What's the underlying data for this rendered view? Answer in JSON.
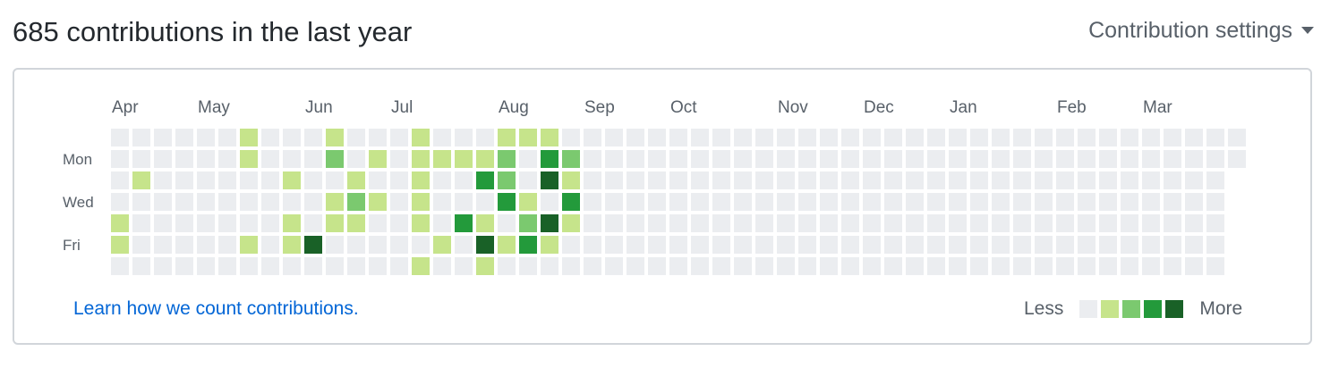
{
  "header": {
    "title": "685 contributions in the last year",
    "settings_label": "Contribution settings",
    "settings_icon": "caret-down-icon"
  },
  "calendar": {
    "months": [
      {
        "label": "Apr",
        "week": 0
      },
      {
        "label": "May",
        "week": 4
      },
      {
        "label": "Jun",
        "week": 9
      },
      {
        "label": "Jul",
        "week": 13
      },
      {
        "label": "Aug",
        "week": 18
      },
      {
        "label": "Sep",
        "week": 22
      },
      {
        "label": "Oct",
        "week": 26
      },
      {
        "label": "Nov",
        "week": 31
      },
      {
        "label": "Dec",
        "week": 35
      },
      {
        "label": "Jan",
        "week": 39
      },
      {
        "label": "Feb",
        "week": 44
      },
      {
        "label": "Mar",
        "week": 48
      }
    ],
    "day_labels": [
      {
        "label": "Mon",
        "row": 1
      },
      {
        "label": "Wed",
        "row": 3
      },
      {
        "label": "Fri",
        "row": 5
      }
    ],
    "week_count": 53,
    "last_week_days": 2,
    "levels": [
      [
        0,
        0,
        0,
        0,
        0,
        0,
        1,
        0,
        0,
        0,
        1,
        0,
        0,
        0,
        1,
        0,
        0,
        0,
        1,
        1,
        1,
        0,
        0,
        0,
        0,
        0,
        0,
        0,
        0,
        0,
        0,
        0,
        0,
        0,
        0,
        0,
        0,
        0,
        0,
        0,
        0,
        0,
        0,
        0,
        0,
        0,
        0,
        0,
        0,
        0,
        0,
        0,
        0
      ],
      [
        0,
        0,
        0,
        0,
        0,
        0,
        1,
        0,
        0,
        0,
        2,
        0,
        1,
        0,
        1,
        1,
        1,
        1,
        2,
        0,
        3,
        2,
        0,
        0,
        0,
        0,
        0,
        0,
        0,
        0,
        0,
        0,
        0,
        0,
        0,
        0,
        0,
        0,
        0,
        0,
        0,
        0,
        0,
        0,
        0,
        0,
        0,
        0,
        0,
        0,
        0,
        0,
        0
      ],
      [
        0,
        1,
        0,
        0,
        0,
        0,
        0,
        0,
        1,
        0,
        0,
        1,
        0,
        0,
        1,
        0,
        0,
        3,
        2,
        0,
        4,
        1,
        0,
        0,
        0,
        0,
        0,
        0,
        0,
        0,
        0,
        0,
        0,
        0,
        0,
        0,
        0,
        0,
        0,
        0,
        0,
        0,
        0,
        0,
        0,
        0,
        0,
        0,
        0,
        0,
        0,
        0
      ],
      [
        0,
        0,
        0,
        0,
        0,
        0,
        0,
        0,
        0,
        0,
        1,
        2,
        1,
        0,
        1,
        0,
        0,
        0,
        3,
        1,
        0,
        3,
        0,
        0,
        0,
        0,
        0,
        0,
        0,
        0,
        0,
        0,
        0,
        0,
        0,
        0,
        0,
        0,
        0,
        0,
        0,
        0,
        0,
        0,
        0,
        0,
        0,
        0,
        0,
        0,
        0,
        0
      ],
      [
        1,
        0,
        0,
        0,
        0,
        0,
        0,
        0,
        1,
        0,
        1,
        1,
        0,
        0,
        1,
        0,
        3,
        1,
        0,
        2,
        4,
        1,
        0,
        0,
        0,
        0,
        0,
        0,
        0,
        0,
        0,
        0,
        0,
        0,
        0,
        0,
        0,
        0,
        0,
        0,
        0,
        0,
        0,
        0,
        0,
        0,
        0,
        0,
        0,
        0,
        0,
        0
      ],
      [
        1,
        0,
        0,
        0,
        0,
        0,
        1,
        0,
        1,
        4,
        0,
        0,
        0,
        0,
        0,
        1,
        0,
        4,
        1,
        3,
        1,
        0,
        0,
        0,
        0,
        0,
        0,
        0,
        0,
        0,
        0,
        0,
        0,
        0,
        0,
        0,
        0,
        0,
        0,
        0,
        0,
        0,
        0,
        0,
        0,
        0,
        0,
        0,
        0,
        0,
        0,
        0
      ],
      [
        0,
        0,
        0,
        0,
        0,
        0,
        0,
        0,
        0,
        0,
        0,
        0,
        0,
        0,
        1,
        0,
        0,
        1,
        0,
        0,
        0,
        0,
        0,
        0,
        0,
        0,
        0,
        0,
        0,
        0,
        0,
        0,
        0,
        0,
        0,
        0,
        0,
        0,
        0,
        0,
        0,
        0,
        0,
        0,
        0,
        0,
        0,
        0,
        0,
        0,
        0,
        0
      ]
    ],
    "colors": [
      "#ebedf0",
      "#c6e48b",
      "#7bc96f",
      "#239a3b",
      "#196127"
    ]
  },
  "footer": {
    "learn_link": "Learn how we count contributions.",
    "legend_less": "Less",
    "legend_more": "More"
  }
}
